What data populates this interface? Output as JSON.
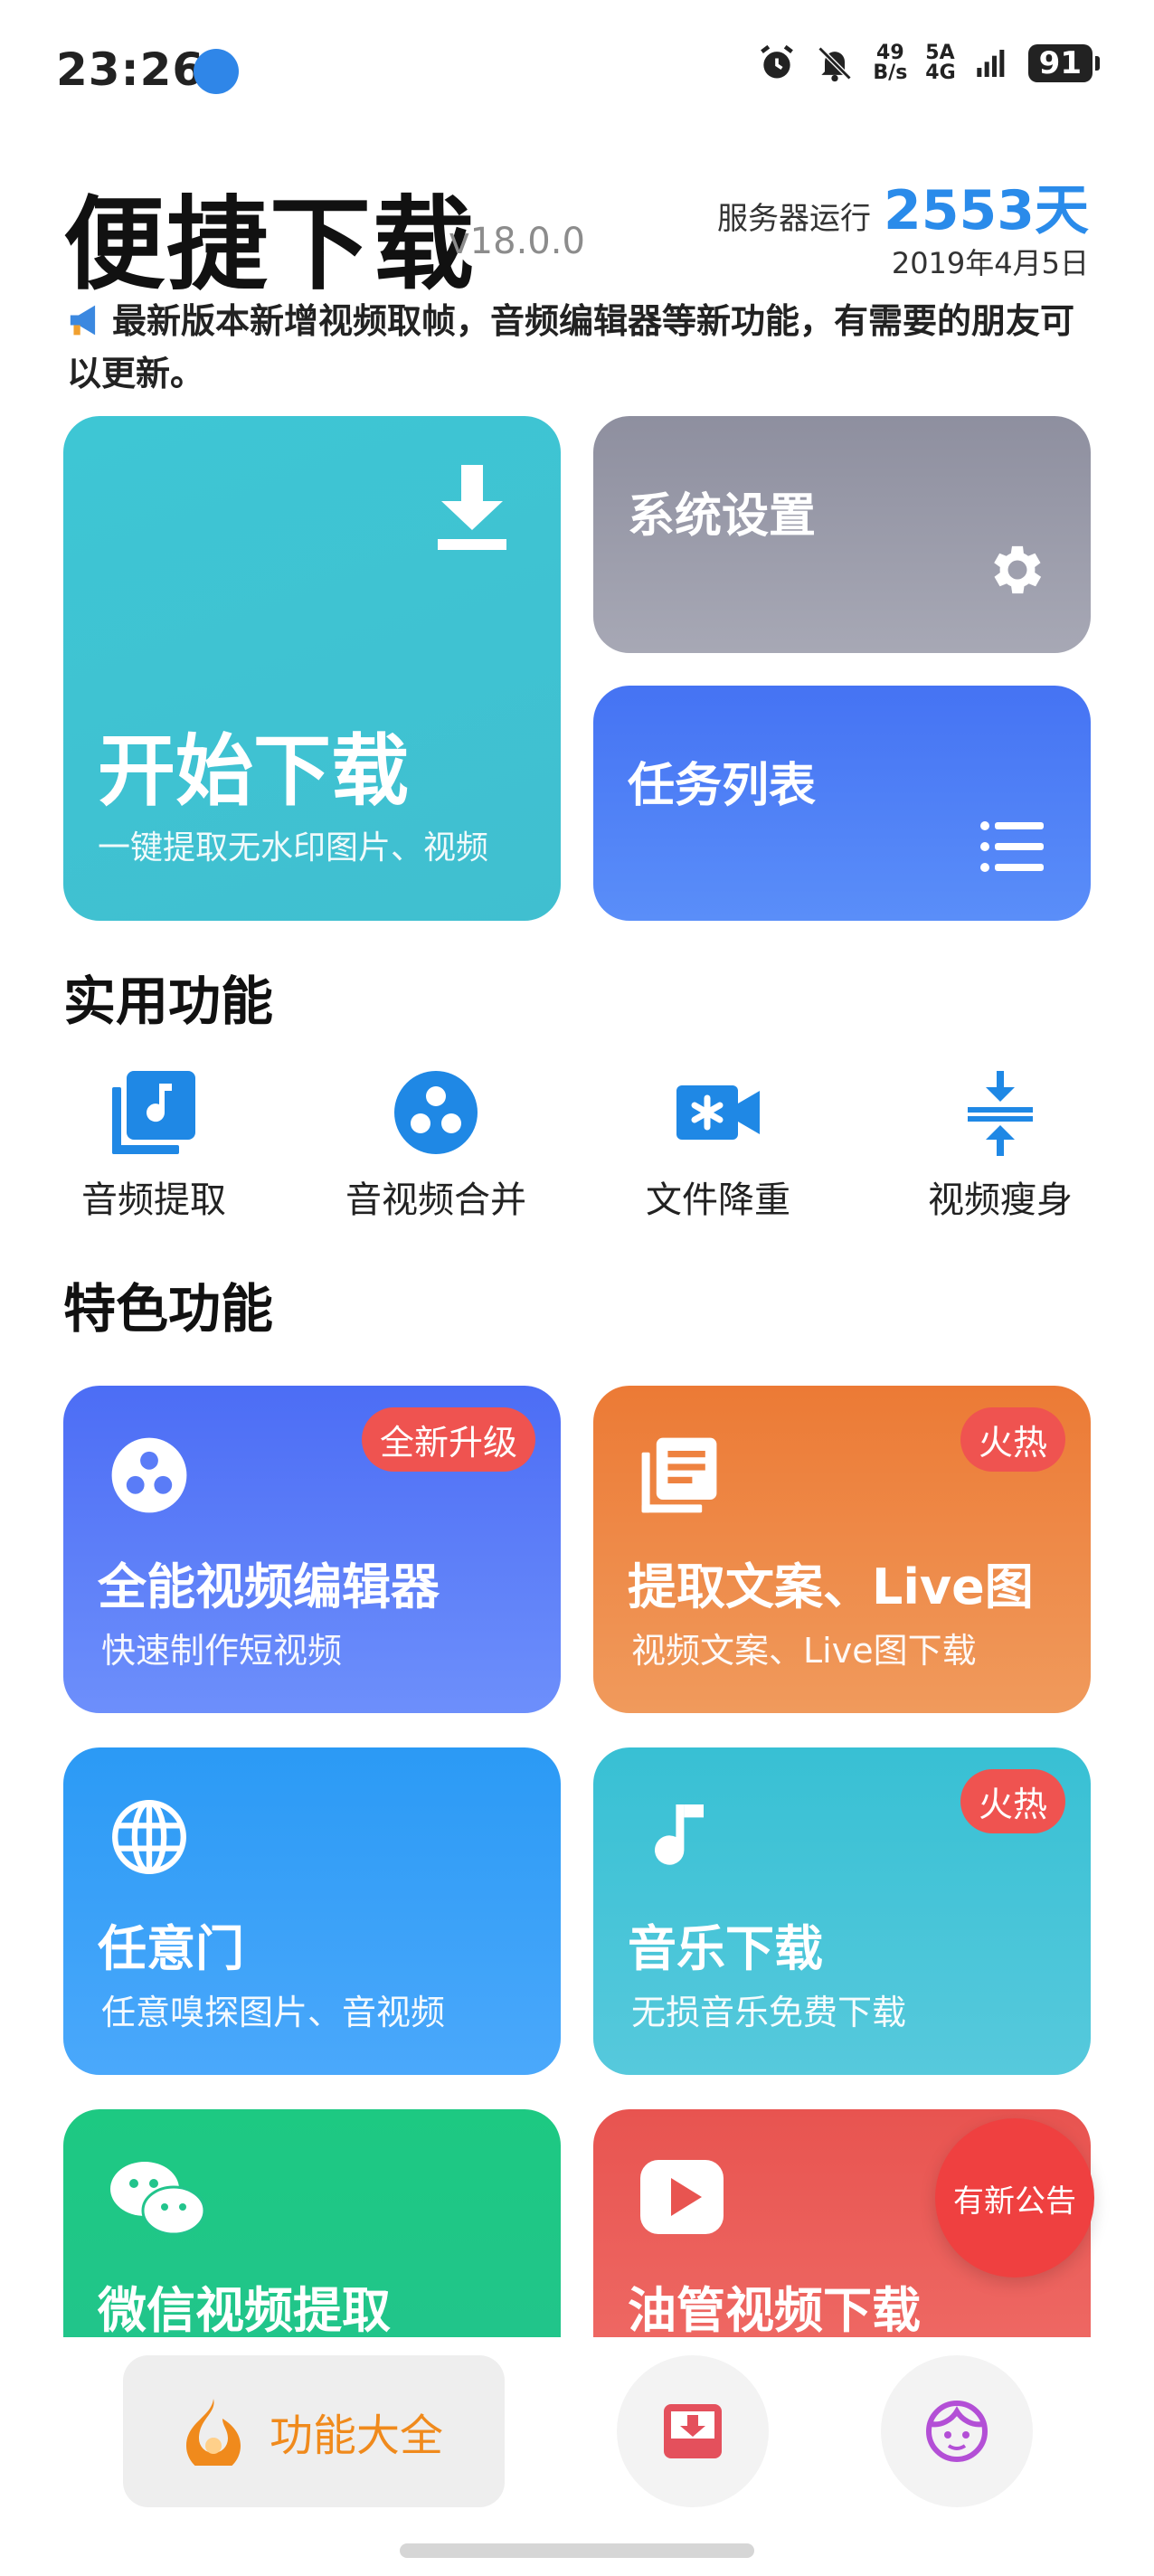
{
  "status_bar": {
    "time": "23:26",
    "net_speed_top": "49",
    "net_speed_bottom": "B/s",
    "signal_top": "5A",
    "signal_bottom": "4G",
    "battery": "91"
  },
  "header": {
    "title": "便捷下载",
    "version": "v18.0.0",
    "server_label": "服务器运行",
    "server_days": "2553天",
    "server_date": "2019年4月5日",
    "notice": "最新版本新增视频取帧，音频编辑器等新功能，有需要的朋友可以更新。"
  },
  "cards": {
    "download_title": "开始下载",
    "download_sub": "一键提取无水印图片、视频",
    "settings_title": "系统设置",
    "tasks_title": "任务列表"
  },
  "practical": {
    "title": "实用功能",
    "items": [
      {
        "label": "音频提取",
        "icon": "audio-extract-icon"
      },
      {
        "label": "音视频合并",
        "icon": "merge-icon"
      },
      {
        "label": "文件降重",
        "icon": "dedupe-icon"
      },
      {
        "label": "视频瘦身",
        "icon": "compress-icon"
      }
    ]
  },
  "special": {
    "title": "特色功能",
    "items": [
      {
        "title": "全能视频编辑器",
        "sub": "快速制作短视频",
        "badge": "全新升级"
      },
      {
        "title": "提取文案、Live图",
        "sub": "视频文案、Live图下载",
        "badge": "火热"
      },
      {
        "title": "任意门",
        "sub": "任意嗅探图片、音视频",
        "badge": ""
      },
      {
        "title": "音乐下载",
        "sub": "无损音乐免费下载",
        "badge": "火热"
      },
      {
        "title": "微信视频提取",
        "sub": "",
        "badge": ""
      },
      {
        "title": "油管视频下载",
        "sub": "",
        "badge": ""
      }
    ],
    "notice_bubble": "有新公告"
  },
  "bottom_nav": {
    "active_label": "功能大全"
  },
  "colors": {
    "accent_blue": "#2a8bea",
    "download_card": "#3ec6d4",
    "settings_card": "#9a9bab",
    "tasks_card": "#4f80f6",
    "nav_active": "#f08a1c"
  }
}
